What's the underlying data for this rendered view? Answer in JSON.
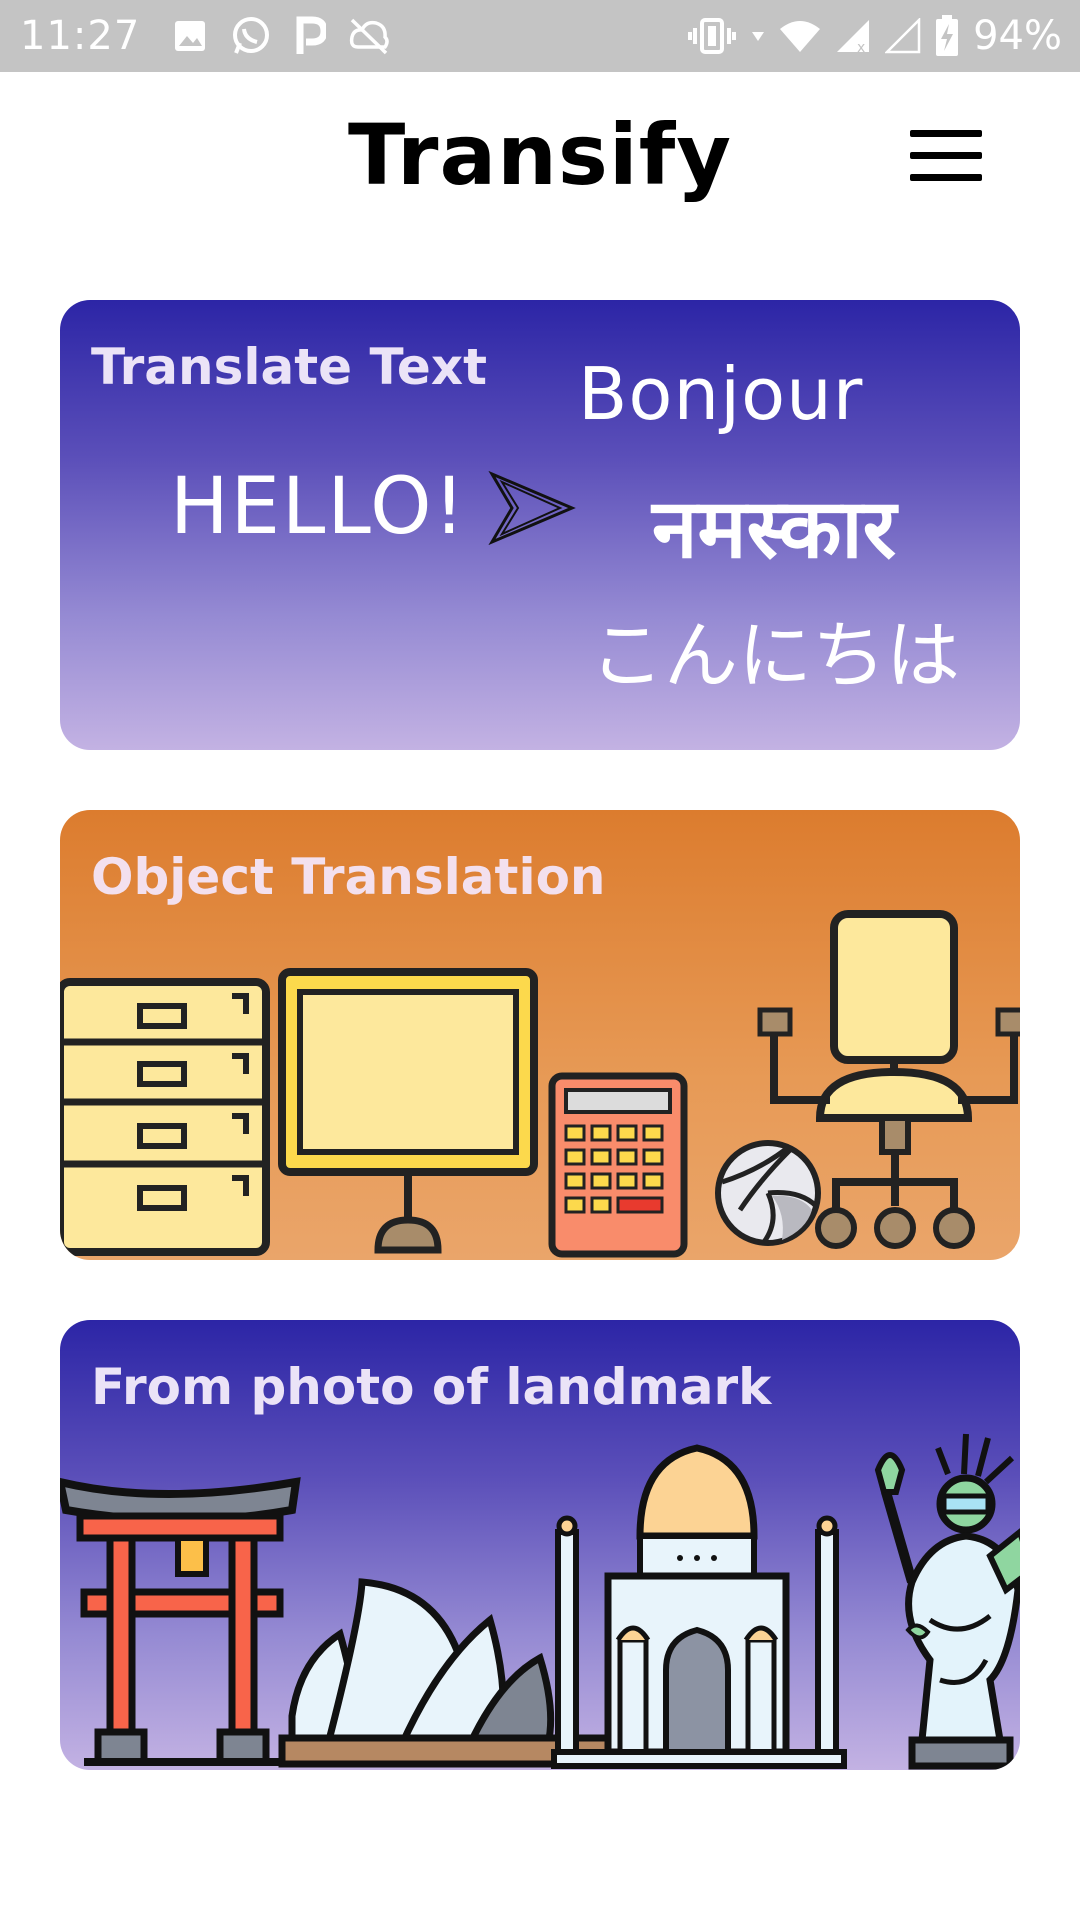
{
  "status_bar": {
    "time": "11:27",
    "battery": "94%",
    "icons_left": [
      "gallery-icon",
      "whatsapp-icon",
      "p-icon",
      "sync-off-icon"
    ],
    "icons_right": [
      "vibrate-icon",
      "wifi-icon",
      "signal-icon",
      "signal-empty-icon",
      "battery-charging-icon"
    ]
  },
  "header": {
    "title": "Transify",
    "menu_icon": "hamburger-menu-icon"
  },
  "cards": [
    {
      "title": "Translate Text",
      "words": {
        "source": "HELLO!",
        "targets": [
          "Bonjour",
          "नमस्कार",
          "こんにちは"
        ]
      },
      "arrow_icon": "arrow-right-icon"
    },
    {
      "title": "Object Translation",
      "illustrations": [
        "filing-cabinet-icon",
        "whiteboard-icon",
        "calculator-icon",
        "volleyball-icon",
        "office-chair-icon"
      ]
    },
    {
      "title": "From photo of landmark",
      "illustrations": [
        "torii-gate-icon",
        "sydney-opera-house-icon",
        "taj-mahal-icon",
        "statue-of-liberty-icon"
      ]
    }
  ],
  "colors": {
    "blue_card_top": "#2c25a6",
    "blue_card_bottom": "#c3b2e3",
    "orange_card_top": "#dc7c2e",
    "orange_card_bottom": "#eaa56a",
    "status_bar": "#c4c4c4"
  }
}
